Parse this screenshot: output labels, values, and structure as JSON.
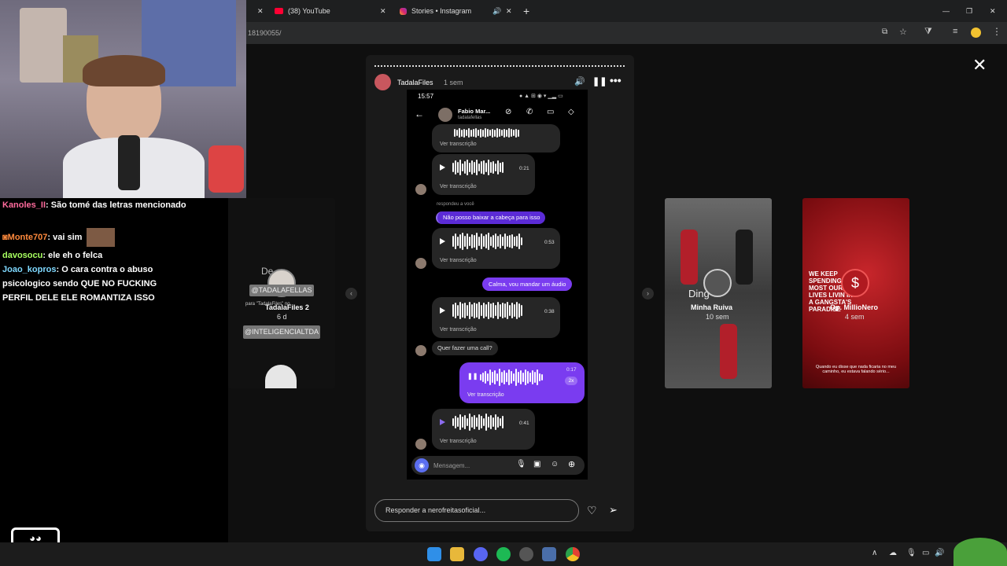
{
  "browser": {
    "tabs": [
      {
        "label": "(38) YouTube"
      },
      {
        "label": "Stories • Instagram"
      }
    ],
    "url": "18190055/"
  },
  "chat": {
    "messages": [
      {
        "user": "Kanoles_II",
        "text": "São tomé das letras mencionado",
        "color": "#ff6b9d"
      },
      {
        "user": "Monte707",
        "text": "vai sim",
        "color": "#ff8a3d"
      },
      {
        "user": "davosocu",
        "text": "ele eh o felca",
        "color": "#a8ff60"
      },
      {
        "user": "Joao_kopros",
        "text": "O cara contra o abuso psicologico sendo QUE NO FUCKING PERFIL DELE ELE ROMANTIZA ISSO",
        "color": "#7fd9ff"
      }
    ]
  },
  "story": {
    "username": "TadalaFiles",
    "time": "1 sem",
    "reply_placeholder": "Responder a nerofreitasoficial...",
    "phone": {
      "clock": "15:57",
      "contact_name": "Fabio Mar...",
      "contact_handle": "tadalafellas",
      "ver_transcricao": "Ver transcrição",
      "respondeu": "respondeu a você",
      "msg_received_1": "Não posso baixar a cabeça para isso",
      "msg_sent_1": "Calma, vou mandar um áudio",
      "msg_received_2": "Quer fazer uma call?",
      "durations": [
        "0:21",
        "0:53",
        "0:38",
        "0:17",
        "0:41"
      ],
      "speed": "2x",
      "input_placeholder": "Mensagem..."
    }
  },
  "left_preview": {
    "title": "TadalaFiles 2",
    "time": "6 d",
    "tag1": "@TADALAFELLAS",
    "tag2": "@INTELIGENCIALTDA",
    "caption": "para \"TadalaFiles\" no",
    "text_top": "De    o"
  },
  "right_previews": [
    {
      "name": "Minha Ruiva",
      "time": "10 sem",
      "overlay": "Ding"
    },
    {
      "name": "Op. MillioNero",
      "time": "4 sem",
      "overlay": "WE KEEP SPENDING MOST OUR LIVES LIVIN IN A GANGSTA'S PARADISE",
      "caption": "Quando eu disse que nada ficaria no meu caminho, eu estava falando sério..."
    }
  ],
  "colors": {
    "sent_bubble": "#7a3cf0",
    "received_purple": "#5b2bd6",
    "chrome_bg": "#1e1f20"
  }
}
